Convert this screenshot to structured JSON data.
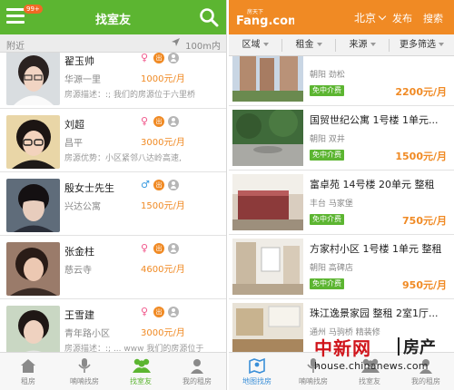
{
  "left_app": {
    "badge": "99+",
    "title": "找室友",
    "nearby_label": "附近",
    "distance_label": "100m内",
    "users": [
      {
        "name": "翟玉帅",
        "gender": "♀",
        "gender_type": "f",
        "rent_tag": "出",
        "location": "华源一里",
        "price": "1000元/月",
        "desc_label": "房源描述：",
        "desc": ":; 我们的房源位于六里桥"
      },
      {
        "name": "刘超",
        "gender": "♀",
        "gender_type": "f",
        "rent_tag": "出",
        "location": "昌平",
        "price": "3000元/月",
        "desc_label": "房源优势：",
        "desc": "小区紧邻八达岭高速,"
      },
      {
        "name": "殷女士先生",
        "gender": "♂",
        "gender_type": "m",
        "rent_tag": "出",
        "location": "兴达公寓",
        "price": "1500元/月",
        "desc_label": "",
        "desc": ""
      },
      {
        "name": "张金柱",
        "gender": "♀",
        "gender_type": "f",
        "rent_tag": "出",
        "location": "慈云寺",
        "price": "4600元/月",
        "desc_label": "",
        "desc": ""
      },
      {
        "name": "王雪建",
        "gender": "♀",
        "gender_type": "f",
        "rent_tag": "出",
        "location": "青年路小区",
        "price": "3000元/月",
        "desc_label": "房源描述：",
        "desc": ":; ... www 我们的房源位于"
      }
    ],
    "tabs": [
      {
        "label": "租房",
        "icon": "home-icon"
      },
      {
        "label": "喃喃找房",
        "icon": "microphone-icon"
      },
      {
        "label": "找室友",
        "icon": "roommates-icon"
      },
      {
        "label": "我的租房",
        "icon": "user-icon"
      }
    ]
  },
  "right_app": {
    "logo_small": "房天下",
    "logo_main": "Fang.com",
    "city": "北京",
    "publish_label": "发布",
    "search_label": "搜索",
    "filters": [
      "区域",
      "租金",
      "来源",
      "更多筛选"
    ],
    "listings": [
      {
        "title": "",
        "area": "朝阳 劲松",
        "tag": "免中介费",
        "price": "2200元/月"
      },
      {
        "title": "国贸世纪公寓 1号楼 1单元...",
        "area": "朝阳 双井",
        "tag": "免中介费",
        "price": "1500元/月"
      },
      {
        "title": "富卓苑 14号楼 20单元 整租",
        "area": "丰台 马家堡",
        "tag": "免中介费",
        "price": "750元/月"
      },
      {
        "title": "方家村小区 1号楼 1单元 整租",
        "area": "朝阳 高碑店",
        "tag": "免中介费",
        "price": "950元/月"
      },
      {
        "title": "珠江逸景家园 整租 2室1厅...",
        "area": "通州 马驹桥 精装修",
        "tag": "",
        "price": ""
      }
    ],
    "tabs": [
      {
        "label": "地图找房",
        "icon": "map-icon"
      },
      {
        "label": "喃喃找房",
        "icon": "microphone-icon"
      },
      {
        "label": "找室友",
        "icon": "roommates-icon"
      },
      {
        "label": "我的租房",
        "icon": "user-icon"
      }
    ]
  },
  "watermark": {
    "brand": "中新网",
    "section": "房产",
    "url": "house.chinanews.com"
  },
  "colors": {
    "left_primary": "#5cb531",
    "right_primary": "#f08a24",
    "price": "#f08a24",
    "tag_green": "#5cb531"
  }
}
